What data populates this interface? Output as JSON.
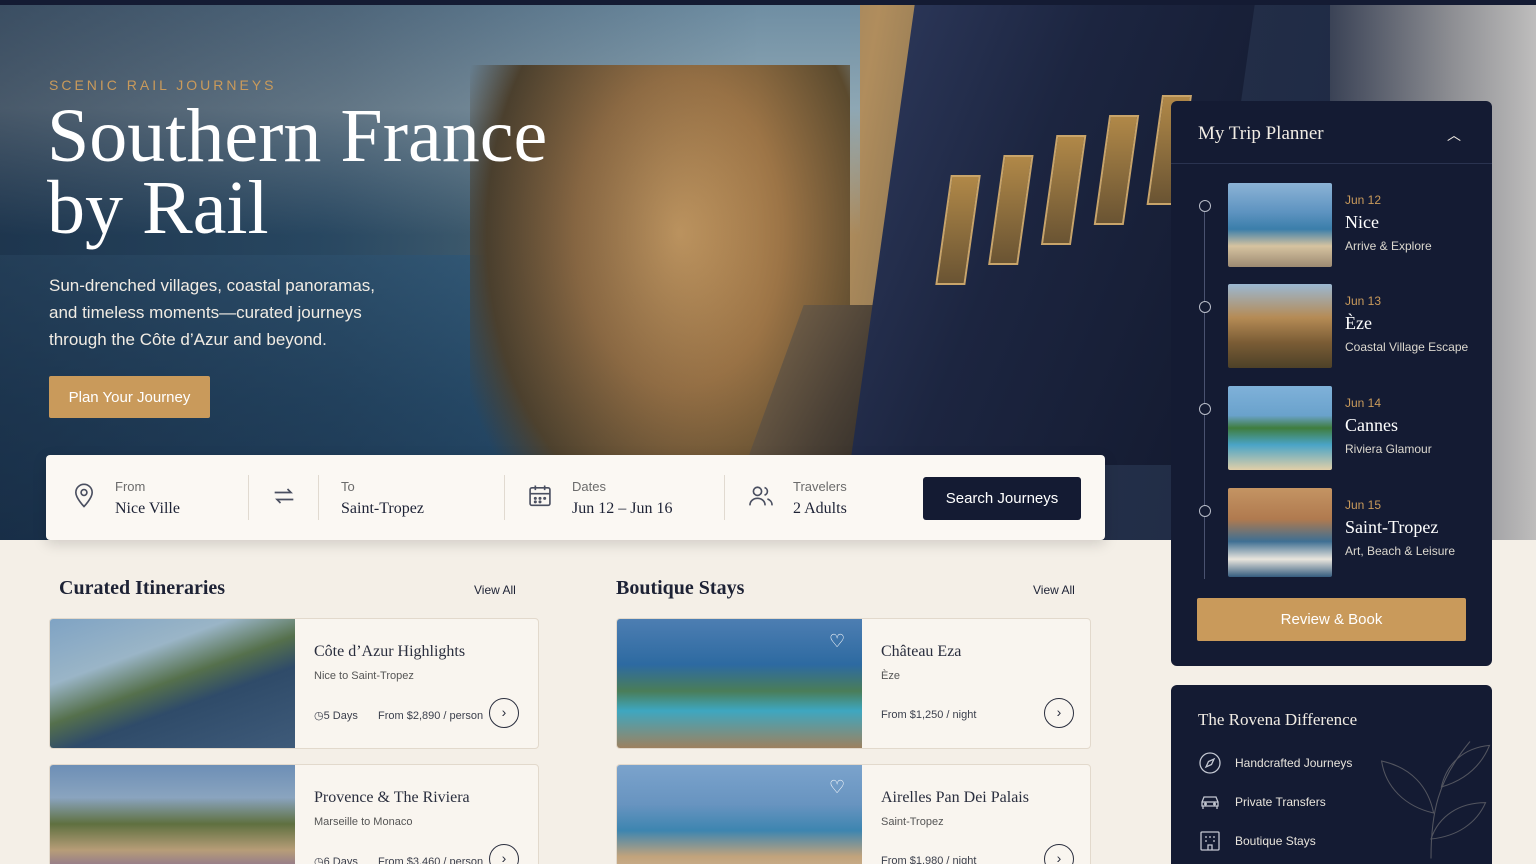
{
  "hero": {
    "eyebrow": "SCENIC RAIL JOURNEYS",
    "title": "Southern France by Rail",
    "subtitle": "Sun-drenched villages, coastal panoramas, and timeless moments—curated journeys through the Côte d’Azur and beyond.",
    "cta": "Plan Your Journey"
  },
  "search": {
    "from_label": "From",
    "from_value": "Nice Ville",
    "to_label": "To",
    "to_value": "Saint-Tropez",
    "dates_label": "Dates",
    "dates_value": "Jun 12 – Jun 16",
    "travelers_label": "Travelers",
    "travelers_value": "2 Adults",
    "button": "Search Journeys"
  },
  "itineraries": {
    "title": "Curated Itineraries",
    "view_all": "View All",
    "items": [
      {
        "title": "Côte d’Azur Highlights",
        "route": "Nice to Saint-Tropez",
        "duration": "5 Days",
        "price": "From $2,890  /  person"
      },
      {
        "title": "Provence & The Riviera",
        "route": "Marseille to Monaco",
        "duration": "6 Days",
        "price": "From $3,460  /  person"
      }
    ]
  },
  "stays": {
    "title": "Boutique Stays",
    "view_all": "View All",
    "items": [
      {
        "title": "Château Eza",
        "location": "Èze",
        "price": "From $1,250  /  night"
      },
      {
        "title": "Airelles Pan Dei Palais",
        "location": "Saint-Tropez",
        "price": "From $1,980  /  night"
      }
    ]
  },
  "planner": {
    "title": "My Trip Planner",
    "stops": [
      {
        "date": "Jun 12",
        "city": "Nice",
        "desc": "Arrive & Explore"
      },
      {
        "date": "Jun 13",
        "city": "Èze",
        "desc": "Coastal Village Escape"
      },
      {
        "date": "Jun 14",
        "city": "Cannes",
        "desc": "Riviera Glamour"
      },
      {
        "date": "Jun 15",
        "city": "Saint-Tropez",
        "desc": "Art, Beach & Leisure"
      }
    ],
    "button": "Review & Book"
  },
  "difference": {
    "title": "The Rovena Difference",
    "items": [
      {
        "label": "Handcrafted Journeys",
        "icon": "compass-icon"
      },
      {
        "label": "Private Transfers",
        "icon": "car-icon"
      },
      {
        "label": "Boutique Stays",
        "icon": "hotel-icon"
      }
    ]
  },
  "colors": {
    "navy": "#141b33",
    "gold": "#c99a5b",
    "cream": "#f4efe7"
  }
}
